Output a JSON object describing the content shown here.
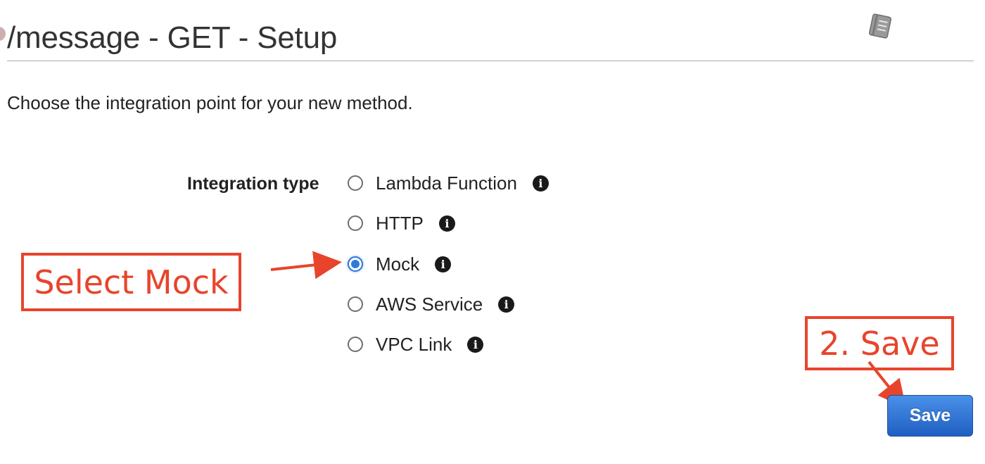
{
  "header": {
    "title": "/message - GET - Setup"
  },
  "instructions": "Choose the integration point for your new method.",
  "form": {
    "label": "Integration type",
    "selected": "Mock",
    "options": [
      {
        "label": "Lambda Function",
        "checked": false
      },
      {
        "label": "HTTP",
        "checked": false
      },
      {
        "label": "Mock",
        "checked": true
      },
      {
        "label": "AWS Service",
        "checked": false
      },
      {
        "label": "VPC Link",
        "checked": false
      }
    ]
  },
  "actions": {
    "save_label": "Save"
  },
  "annotations": {
    "select_mock": "Select Mock",
    "save_step": "2. Save",
    "color": "#e8442c"
  },
  "icons": {
    "info": "info-icon",
    "notebook": "notebook-icon"
  },
  "colors": {
    "primary_button": "#2f6fd2",
    "radio_selected": "#2f7ad8"
  }
}
